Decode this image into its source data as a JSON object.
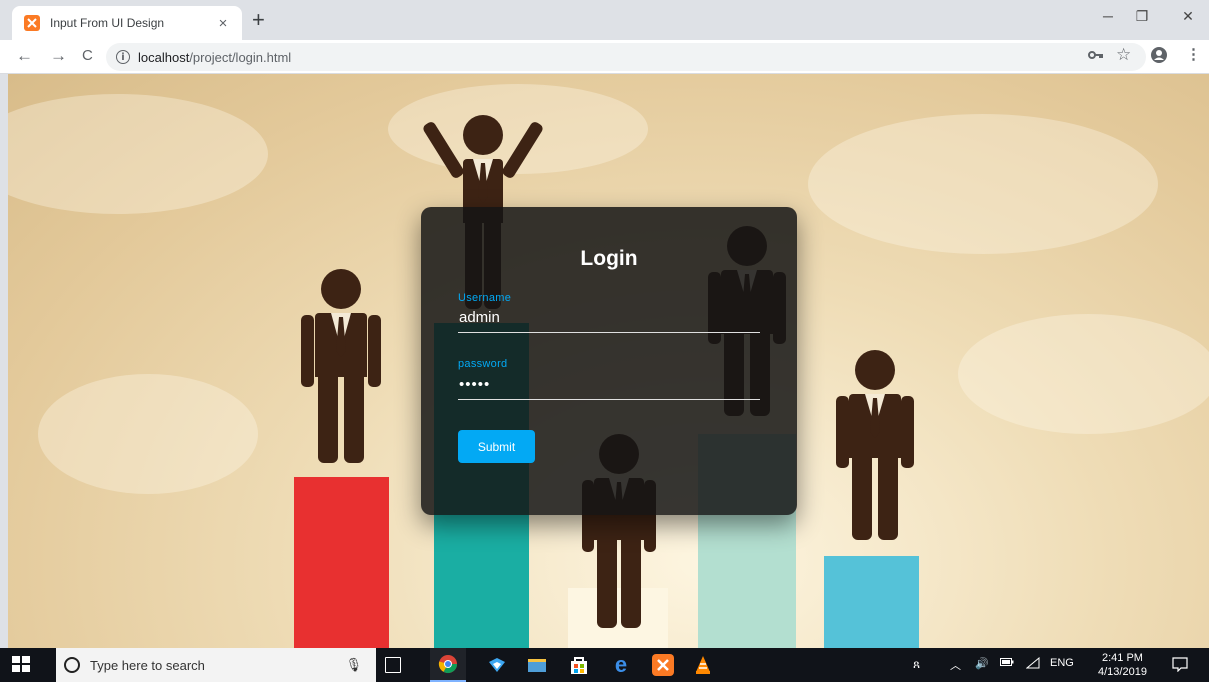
{
  "browser": {
    "tab_title": "Input From UI Design",
    "tab_close": "×",
    "new_tab": "+",
    "url_host": "localhost",
    "url_path": "/project/login.html",
    "window_controls": [
      "─",
      "❐",
      "✕"
    ],
    "nav": {
      "back": "←",
      "forward": "→",
      "reload": "C"
    },
    "toolbar_icons": [
      "key-icon",
      "star-icon",
      "profile-icon",
      "menu-icon"
    ]
  },
  "login": {
    "title": "Login",
    "username_label": "Username",
    "username_value": "admin",
    "password_label": "password",
    "password_value": "•••••",
    "submit_label": "Submit"
  },
  "background": {
    "bar_colors": [
      "#e83030",
      "#1aaea3",
      "#fdf6e2",
      "#b3dfd0",
      "#55c2d8"
    ],
    "figure_color": "#3d2314"
  },
  "taskbar": {
    "search_placeholder": "Type here to search",
    "time": "2:41 PM",
    "date": "4/13/2019",
    "language": "ENG",
    "pinned": [
      "task-view-icon",
      "chrome-icon",
      "vscode-icon",
      "file-explorer-icon",
      "store-icon",
      "edge-icon",
      "xampp-icon",
      "vlc-icon"
    ]
  }
}
